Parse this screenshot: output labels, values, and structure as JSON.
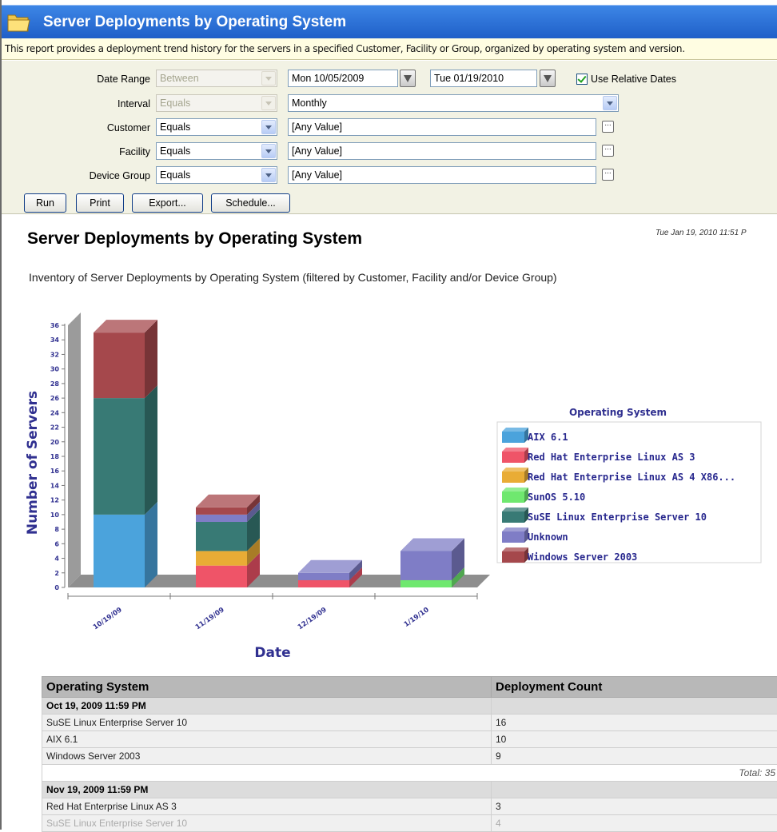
{
  "header": {
    "title": "Server Deployments by Operating System",
    "description": "This report provides a deployment trend history for the servers in a specified Customer, Facility or Group, organized by operating system and version."
  },
  "filters": {
    "date_range": {
      "label": "Date Range",
      "operator": "Between",
      "from": "Mon 10/05/2009",
      "to": "Tue 01/19/2010",
      "relative_label": "Use Relative Dates",
      "relative_checked": true
    },
    "interval": {
      "label": "Interval",
      "operator": "Equals",
      "value": "Monthly"
    },
    "customer": {
      "label": "Customer",
      "operator": "Equals",
      "value": "[Any Value]"
    },
    "facility": {
      "label": "Facility",
      "operator": "Equals",
      "value": "[Any Value]"
    },
    "device_group": {
      "label": "Device Group",
      "operator": "Equals",
      "value": "[Any Value]"
    }
  },
  "buttons": {
    "run": "Run",
    "print": "Print",
    "export": "Export...",
    "schedule": "Schedule..."
  },
  "report": {
    "title": "Server Deployments by Operating System",
    "timestamp": "Tue Jan 19, 2010 11:51 P",
    "subtitle": "Inventory of Server Deployments by Operating System (filtered by Customer, Facility and/or Device Group)"
  },
  "chart_data": {
    "type": "bar",
    "stacked": true,
    "three_d": true,
    "categories": [
      "10/19/09",
      "11/19/09",
      "12/19/09",
      "1/19/10"
    ],
    "xlabel": "Date",
    "ylabel": "Number of Servers",
    "ylim": [
      0,
      36
    ],
    "ytick_step": 2,
    "legend_title": "Operating System",
    "legend_position": "right",
    "series": [
      {
        "name": "AIX 6.1",
        "values": [
          10,
          0,
          0,
          0
        ],
        "color": "#4ba3dc"
      },
      {
        "name": "Red Hat Enterprise Linux AS 3",
        "values": [
          0,
          3,
          1,
          0
        ],
        "color": "#ef5468"
      },
      {
        "name": "Red Hat Enterprise Linux AS 4 X86...",
        "values": [
          0,
          2,
          0,
          0
        ],
        "color": "#e9ac35"
      },
      {
        "name": "SunOS 5.10",
        "values": [
          0,
          0,
          0,
          1
        ],
        "color": "#6fe86f"
      },
      {
        "name": "SuSE Linux Enterprise Server 10",
        "values": [
          16,
          4,
          0,
          0
        ],
        "color": "#387a75"
      },
      {
        "name": "Unknown",
        "values": [
          0,
          1,
          1,
          4
        ],
        "color": "#7f7dc6"
      },
      {
        "name": "Windows Server 2003",
        "values": [
          9,
          1,
          0,
          0
        ],
        "color": "#a5484c"
      }
    ]
  },
  "table": {
    "headers": [
      "Operating System",
      "Deployment Count"
    ],
    "groups": [
      {
        "label": "Oct 19, 2009 11:59 PM",
        "rows": [
          {
            "os": "SuSE Linux Enterprise Server 10",
            "count": "16"
          },
          {
            "os": "AIX 6.1",
            "count": "10"
          },
          {
            "os": "Windows Server 2003",
            "count": "9"
          }
        ],
        "total": "Total: 35"
      },
      {
        "label": "Nov 19, 2009 11:59 PM",
        "rows": [
          {
            "os": "Red Hat Enterprise Linux AS 3",
            "count": "3"
          },
          {
            "os": "SuSE Linux Enterprise Server 10",
            "count": "4"
          }
        ]
      }
    ]
  }
}
